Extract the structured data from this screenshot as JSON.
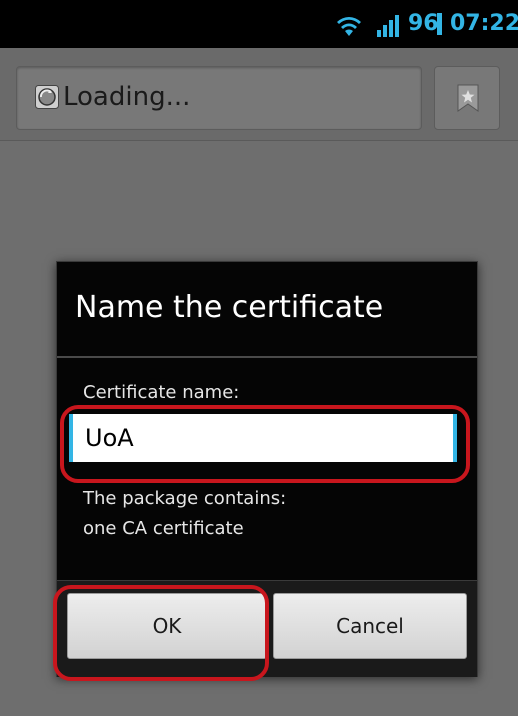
{
  "status_bar": {
    "battery": "96",
    "time": "07:22",
    "icons": [
      "wifi-icon",
      "signal-icon"
    ],
    "accent_color": "#33b5e5"
  },
  "browser": {
    "url_text": "Loading...",
    "icons": [
      "globe-icon",
      "bookmark-icon"
    ]
  },
  "dialog": {
    "title": "Name the certificate",
    "field_label": "Certificate name:",
    "field_value": "UoA",
    "package_line1": "The package contains:",
    "package_line2": "one CA certificate",
    "ok_label": "OK",
    "cancel_label": "Cancel"
  },
  "annotation": {
    "highlight_color": "#c8161d"
  }
}
